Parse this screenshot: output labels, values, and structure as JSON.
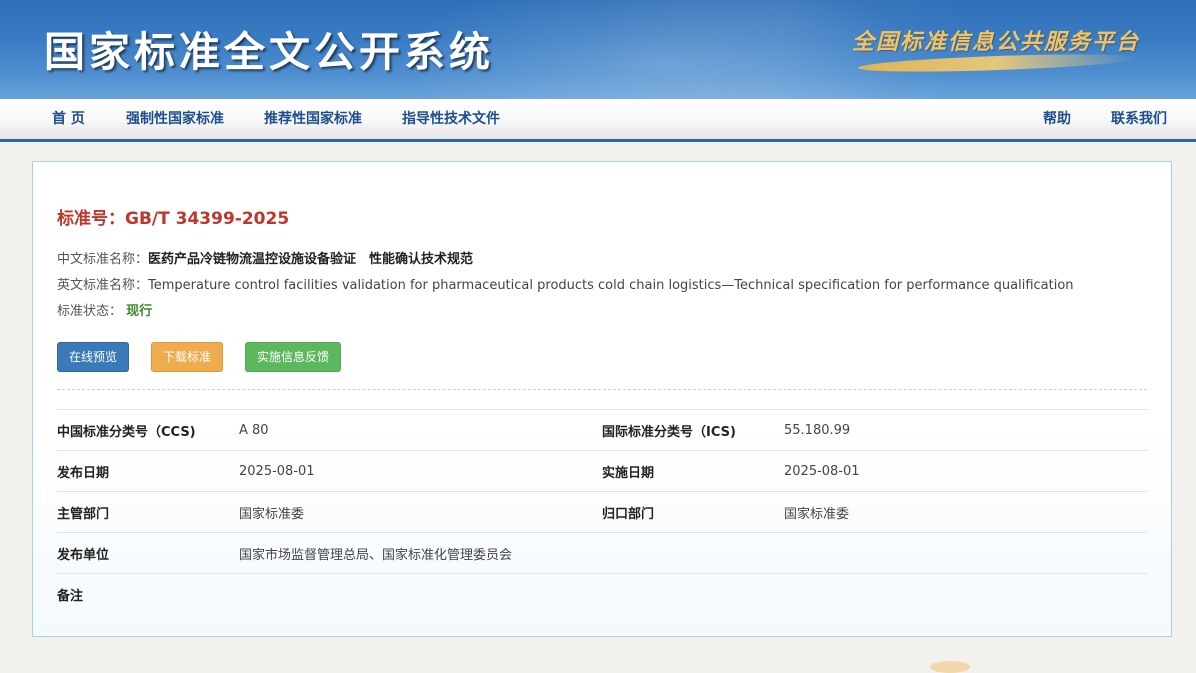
{
  "header": {
    "site_title": "国家标准全文公开系统",
    "slogan": "全国标准信息公共服务平台"
  },
  "nav": {
    "left": [
      "首 页",
      "强制性国家标准",
      "推荐性国家标准",
      "指导性技术文件"
    ],
    "right": [
      "帮助",
      "联系我们"
    ]
  },
  "standard": {
    "number_label": "标准号：GB/T 34399-2025",
    "cn_name_label": "中文标准名称：",
    "cn_name": "医药产品冷链物流温控设施设备验证　性能确认技术规范",
    "en_name_label": "英文标准名称：",
    "en_name": "Temperature control facilities validation for pharmaceutical products cold chain logistics—Technical specification for performance qualification",
    "status_label": "标准状态：",
    "status": "现行"
  },
  "actions": {
    "preview": "在线预览",
    "download": "下载标准",
    "feedback": "实施信息反馈"
  },
  "details": {
    "ccs_label": "中国标准分类号（CCS)",
    "ccs": "A 80",
    "ics_label": "国际标准分类号（ICS)",
    "ics": "55.180.99",
    "publish_date_label": "发布日期",
    "publish_date": "2025-08-01",
    "impl_date_label": "实施日期",
    "impl_date": "2025-08-01",
    "dept_label": "主管部门",
    "dept": "国家标准委",
    "belong_label": "归口部门",
    "belong": "国家标准委",
    "publisher_label": "发布单位",
    "publisher": "国家市场监督管理总局、国家标准化管理委员会",
    "remark_label": "备注",
    "remark": ""
  },
  "colors": {
    "brand_blue": "#2e64a8",
    "std_red": "#c0352b",
    "status_green": "#3d8a2e",
    "btn_blue": "#3a7ab9",
    "btn_orange": "#efac4f",
    "btn_green": "#5cb85c"
  }
}
